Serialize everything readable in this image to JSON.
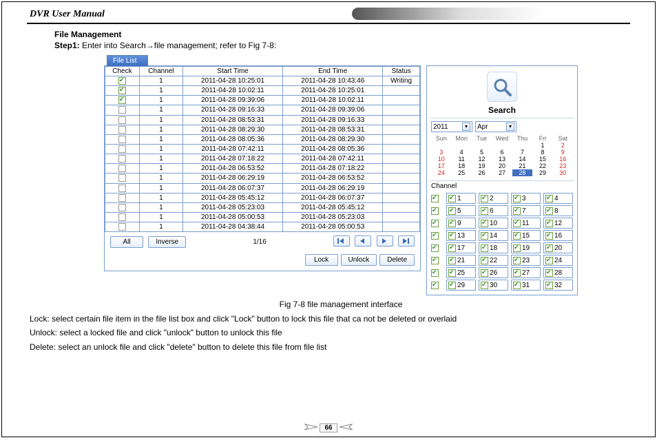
{
  "header": {
    "title": "DVR User Manual"
  },
  "section": {
    "title": "File Management",
    "step1_label": "Step1:",
    "step1_text_a": " Enter into Search",
    "step1_text_b": "file management; refer to Fig 7-8:"
  },
  "file_panel": {
    "tab": "File List",
    "columns": {
      "check": "Check",
      "channel": "Channel",
      "start": "Start Time",
      "end": "End Time",
      "status": "Status"
    },
    "rows": [
      {
        "checked": true,
        "channel": "1",
        "start": "2011-04-28 10:25:01",
        "end": "2011-04-28 10:43:46",
        "status": "Writing"
      },
      {
        "checked": true,
        "channel": "1",
        "start": "2011-04-28 10:02:11",
        "end": "2011-04-28 10:25:01",
        "status": ""
      },
      {
        "checked": true,
        "channel": "1",
        "start": "2011-04-28 09:39:06",
        "end": "2011-04-28 10:02:11",
        "status": ""
      },
      {
        "checked": false,
        "channel": "1",
        "start": "2011-04-28 09:16:33",
        "end": "2011-04-28 09:39:06",
        "status": ""
      },
      {
        "checked": false,
        "channel": "1",
        "start": "2011-04-28 08:53:31",
        "end": "2011-04-28 09:16:33",
        "status": ""
      },
      {
        "checked": false,
        "channel": "1",
        "start": "2011-04-28 08:29:30",
        "end": "2011-04-28 08:53:31",
        "status": ""
      },
      {
        "checked": false,
        "channel": "1",
        "start": "2011-04-28 08:05:36",
        "end": "2011-04-28 08:29:30",
        "status": ""
      },
      {
        "checked": false,
        "channel": "1",
        "start": "2011-04-28 07:42:11",
        "end": "2011-04-28 08:05:36",
        "status": ""
      },
      {
        "checked": false,
        "channel": "1",
        "start": "2011-04-28 07:18:22",
        "end": "2011-04-28 07:42:11",
        "status": ""
      },
      {
        "checked": false,
        "channel": "1",
        "start": "2011-04-28 06:53:52",
        "end": "2011-04-28 07:18:22",
        "status": ""
      },
      {
        "checked": false,
        "channel": "1",
        "start": "2011-04-28 06:29:19",
        "end": "2011-04-28 06:53:52",
        "status": ""
      },
      {
        "checked": false,
        "channel": "1",
        "start": "2011-04-28 06:07:37",
        "end": "2011-04-28 06:29:19",
        "status": ""
      },
      {
        "checked": false,
        "channel": "1",
        "start": "2011-04-28 05:45:12",
        "end": "2011-04-28 06:07:37",
        "status": ""
      },
      {
        "checked": false,
        "channel": "1",
        "start": "2011-04-28 05:23:03",
        "end": "2011-04-28 05:45:12",
        "status": ""
      },
      {
        "checked": false,
        "channel": "1",
        "start": "2011-04-28 05:00:53",
        "end": "2011-04-28 05:23:03",
        "status": ""
      },
      {
        "checked": false,
        "channel": "1",
        "start": "2011-04-28 04:38:44",
        "end": "2011-04-28 05:00:53",
        "status": ""
      }
    ],
    "buttons": {
      "all": "All",
      "inverse": "Inverse",
      "lock": "Lock",
      "unlock": "Unlock",
      "delete": "Delete"
    },
    "page_indicator": "1/16"
  },
  "search_panel": {
    "label": "Search",
    "year": "2011",
    "month": "Apr",
    "weekdays": [
      "Sun",
      "Mon",
      "Tue",
      "Wed",
      "Thu",
      "Fri",
      "Sat"
    ],
    "calendar": [
      [
        "",
        "",
        "",
        "",
        "",
        "1",
        "2"
      ],
      [
        "3",
        "4",
        "5",
        "6",
        "7",
        "8",
        "9"
      ],
      [
        "10",
        "11",
        "12",
        "13",
        "14",
        "15",
        "16"
      ],
      [
        "17",
        "18",
        "19",
        "20",
        "21",
        "22",
        "23"
      ],
      [
        "24",
        "25",
        "26",
        "27",
        "28",
        "29",
        "30"
      ]
    ],
    "today": "28",
    "channel_label": "Channel",
    "channels": [
      "1",
      "2",
      "3",
      "4",
      "5",
      "6",
      "7",
      "8",
      "9",
      "10",
      "11",
      "12",
      "13",
      "14",
      "15",
      "16",
      "17",
      "18",
      "19",
      "20",
      "21",
      "22",
      "23",
      "24",
      "25",
      "26",
      "27",
      "28",
      "29",
      "30",
      "31",
      "32"
    ]
  },
  "caption": "Fig 7-8 file management interface",
  "notes": {
    "lock": "Lock: select certain file item in the file list box and click \"Lock\" button to lock this file that ca not be deleted or overlaid",
    "unlock": "Unlock: select a locked file and click \"unlock\" button to unlock this file",
    "delete": "Delete: select an unlock file and click \"delete\" button to delete this file from file list"
  },
  "page_number": "66"
}
